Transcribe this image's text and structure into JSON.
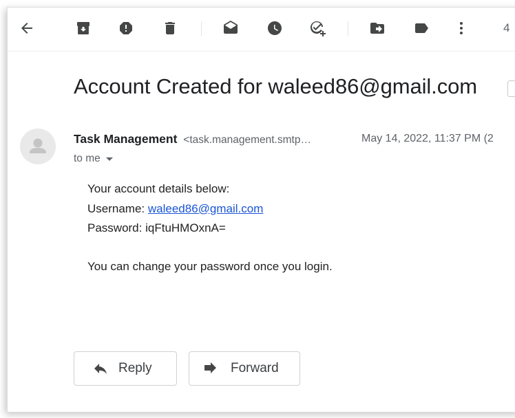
{
  "toolbar": {
    "icons": [
      "back-arrow-icon",
      "archive-icon",
      "report-spam-icon",
      "delete-icon",
      "mark-unread-icon",
      "snooze-icon",
      "add-to-tasks-icon",
      "move-to-icon",
      "label-icon",
      "more-options-icon"
    ],
    "page_count": "4"
  },
  "email": {
    "subject": "Account Created for waleed86@gmail.com",
    "sender_name": "Task Management",
    "sender_email": "<task.management.smtp…",
    "date": "May 14, 2022, 11:37 PM (2",
    "recipient": "to me",
    "body": {
      "line1": "Your account details below:",
      "username_label": "Username:",
      "username_value": "waleed86@gmail.com",
      "password_label": "Password:",
      "password_value": "iqFtuHMOxnA=",
      "line4": "You can change your password once you login."
    }
  },
  "actions": {
    "reply_label": "Reply",
    "forward_label": "Forward"
  },
  "colors": {
    "link": "#1a55d6",
    "icon": "#444746"
  }
}
